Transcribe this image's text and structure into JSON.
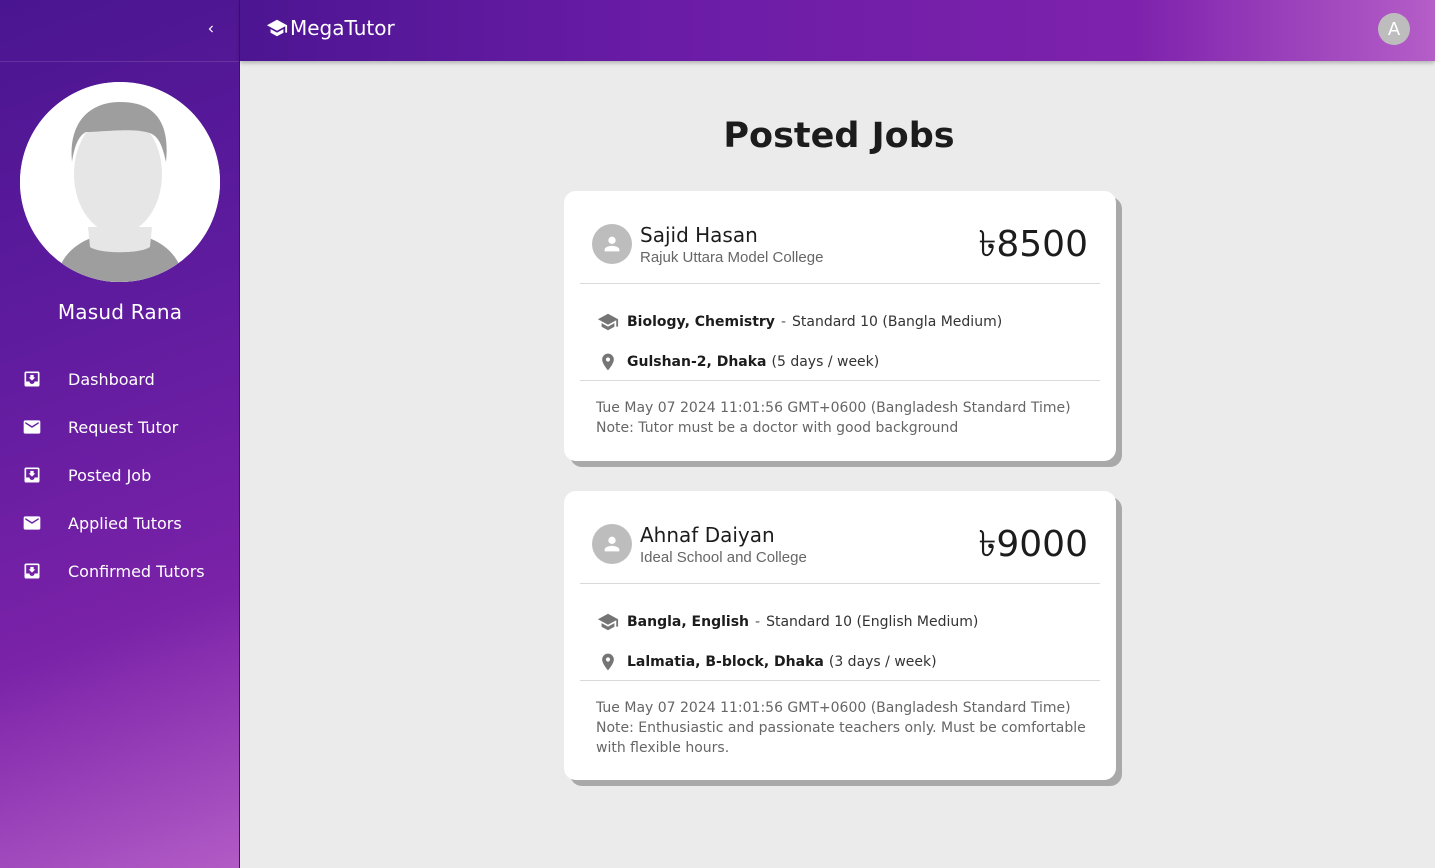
{
  "brand": {
    "name": "MegaTutor"
  },
  "header": {
    "avatar_letter": "A"
  },
  "sidebar": {
    "user_name": "Masud Rana",
    "items": [
      {
        "label": "Dashboard",
        "icon": "inbox-download-icon"
      },
      {
        "label": "Request Tutor",
        "icon": "mail-icon"
      },
      {
        "label": "Posted Job",
        "icon": "inbox-download-icon"
      },
      {
        "label": "Applied Tutors",
        "icon": "mail-icon"
      },
      {
        "label": "Confirmed Tutors",
        "icon": "inbox-download-icon"
      }
    ]
  },
  "main": {
    "title": "Posted Jobs",
    "jobs": [
      {
        "name": "Sajid Hasan",
        "school": "Rajuk Uttara Model College",
        "price": "৳8500",
        "subjects": "Biology, Chemistry",
        "standard": "Standard 10 (Bangla Medium)",
        "location": "Gulshan-2, Dhaka",
        "frequency": "(5 days / week)",
        "date": "Tue May 07 2024 11:01:56 GMT+0600 (Bangladesh Standard Time)",
        "note": "Note: Tutor must be a doctor with good background"
      },
      {
        "name": "Ahnaf Daiyan",
        "school": "Ideal School and College",
        "price": "৳9000",
        "subjects": "Bangla, English",
        "standard": "Standard 10 (English Medium)",
        "location": "Lalmatia, B-block, Dhaka",
        "frequency": "(3 days / week)",
        "date": "Tue May 07 2024 11:01:56 GMT+0600 (Bangladesh Standard Time)",
        "note": "Note: Enthusiastic and passionate teachers only. Must be comfortable with flexible hours."
      }
    ]
  },
  "colors": {
    "sidebar_gradient_start": "#4a1590",
    "sidebar_gradient_end": "#b25bc6",
    "background": "#ebebeb",
    "card": "#ffffff"
  }
}
